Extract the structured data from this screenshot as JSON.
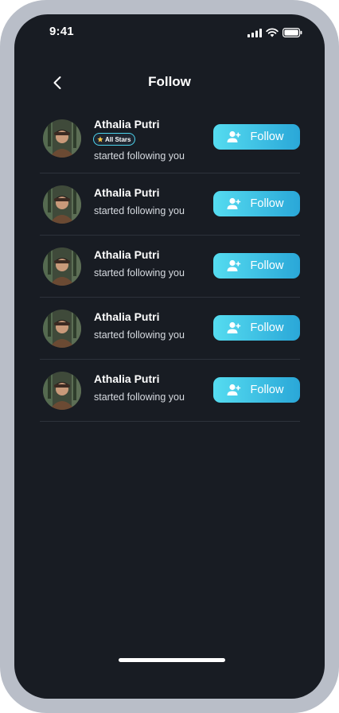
{
  "status_bar": {
    "time": "9:41"
  },
  "header": {
    "title": "Follow",
    "back_icon": "chevron-left-icon"
  },
  "theme": {
    "background": "#181c23",
    "accent_start": "#55dcf0",
    "accent_end": "#2aa7d8",
    "badge_border": "#4cd3ec"
  },
  "follows": [
    {
      "name": "Athalia Putri",
      "badge": "All Stars",
      "subtitle": "started following you",
      "button": "Follow"
    },
    {
      "name": "Athalia Putri",
      "subtitle": "started following you",
      "button": "Follow"
    },
    {
      "name": "Athalia Putri",
      "subtitle": "started following you",
      "button": "Follow"
    },
    {
      "name": "Athalia Putri",
      "subtitle": "started following you",
      "button": "Follow"
    },
    {
      "name": "Athalia Putri",
      "subtitle": "started following you",
      "button": "Follow"
    }
  ]
}
